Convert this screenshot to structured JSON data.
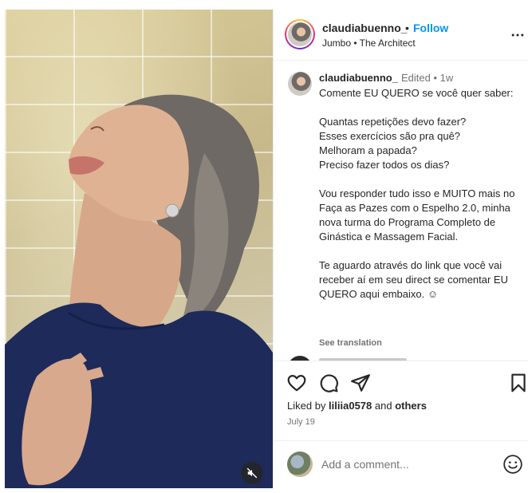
{
  "post": {
    "username": "claudiabuenno_",
    "separator": "•",
    "follow_label": "Follow",
    "audio": "Jumbo • The Architect"
  },
  "caption": {
    "username": "claudiabuenno_",
    "meta": "Edited • 1w",
    "text": "Comente EU QUERO se você quer saber:\n\nQuantas repetições devo fazer?\nEsses exercícios são pra quê?\nMelhoram a papada?\nPreciso fazer todos os dias?\n\nVou responder tudo isso e MUITO mais no Faça as Pazes com o Espelho 2.0, minha nova turma do Programa Completo de Ginástica e Massagem Facial.\n\nTe aguardo através do link que você vai receber aí em seu direct se comentar EU QUERO aqui embaixo. ☺",
    "see_translation": "See translation"
  },
  "likes": {
    "prefix": "Liked by",
    "user": "liliia0578",
    "conjunction": "and",
    "others": "others"
  },
  "date": "July 19",
  "comment": {
    "placeholder": "Add a comment..."
  },
  "icons": {
    "like": "heart-icon",
    "comment": "comment-icon",
    "share": "share-icon",
    "save": "bookmark-icon",
    "more": "more-icon",
    "mute": "muted-speaker-icon",
    "emoji": "emoji-icon"
  },
  "colors": {
    "accent": "#0095f6",
    "text": "#262626",
    "muted": "#737373",
    "divider": "#efefef",
    "shirt": "#1e2a5a"
  }
}
